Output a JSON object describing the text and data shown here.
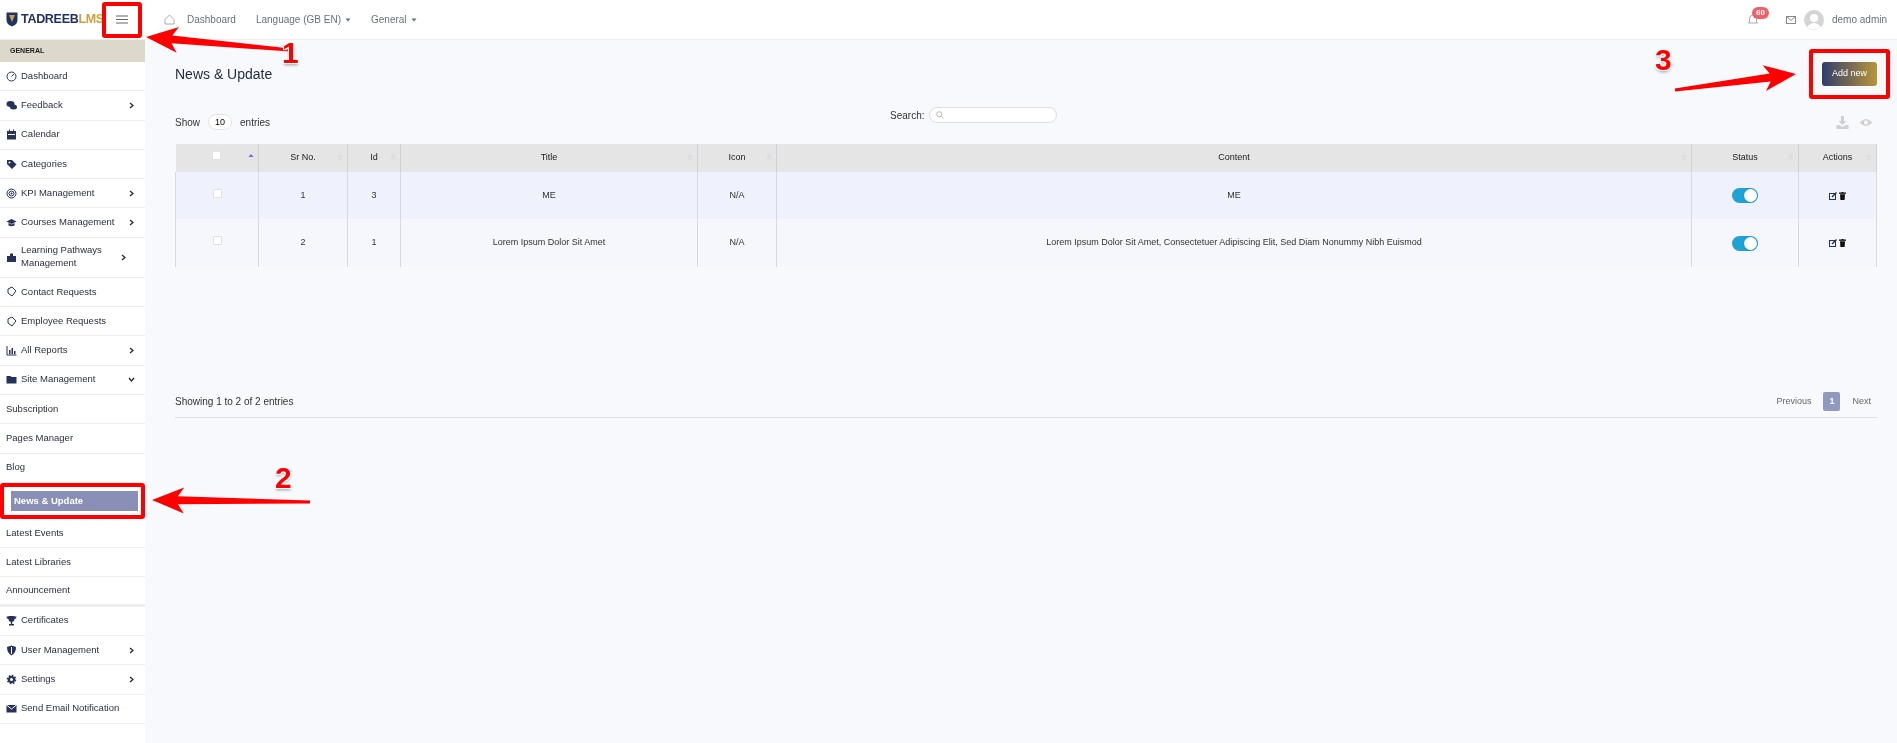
{
  "header": {
    "logo": {
      "primary": "TADREEB",
      "accent": "LMS"
    },
    "nav": [
      {
        "label": "Dashboard",
        "dropdown": false
      },
      {
        "label": "Language (GB EN)",
        "dropdown": true
      },
      {
        "label": "General",
        "dropdown": true
      }
    ],
    "notification_count": "60",
    "user_name": "demo admin"
  },
  "sidebar": {
    "section": "GENERAL",
    "items": [
      {
        "label": "Dashboard",
        "kind": "main",
        "selected": false
      },
      {
        "label": "Feedback",
        "kind": "main",
        "expanded": false,
        "selected": false
      },
      {
        "label": "Calendar",
        "kind": "main",
        "selected": false
      },
      {
        "label": "Categories",
        "kind": "main",
        "selected": false
      },
      {
        "label": "KPI Management",
        "kind": "main",
        "expanded": false,
        "selected": false
      },
      {
        "label": "Courses Management",
        "kind": "main",
        "expanded": false,
        "selected": false
      },
      {
        "label": "Learning Pathways Management",
        "kind": "main",
        "expanded": false,
        "selected": false
      },
      {
        "label": "Contact Requests",
        "kind": "main",
        "selected": false
      },
      {
        "label": "Employee Requests",
        "kind": "main",
        "selected": false
      },
      {
        "label": "All Reports",
        "kind": "main",
        "expanded": false,
        "selected": false
      },
      {
        "label": "Site Management",
        "kind": "main",
        "expanded": true,
        "selected": false
      },
      {
        "label": "Subscription",
        "kind": "sub",
        "selected": false
      },
      {
        "label": "Pages Manager",
        "kind": "sub",
        "selected": false
      },
      {
        "label": "Blog",
        "kind": "sub",
        "selected": false
      },
      {
        "label": "News & Update",
        "kind": "sub",
        "selected": true
      },
      {
        "label": "Latest Events",
        "kind": "sub",
        "selected": false
      },
      {
        "label": "Latest Libraries",
        "kind": "sub",
        "selected": false
      },
      {
        "label": "Announcement",
        "kind": "sub",
        "selected": false
      },
      {
        "label": "Certificates",
        "kind": "main",
        "selected": false
      },
      {
        "label": "User Management",
        "kind": "main",
        "expanded": false,
        "selected": false
      },
      {
        "label": "Settings",
        "kind": "main",
        "expanded": false,
        "selected": false
      },
      {
        "label": "Send Email Notification",
        "kind": "main",
        "selected": false
      }
    ]
  },
  "page": {
    "title": "News & Update",
    "add_button": "Add new",
    "length_prefix": "Show",
    "length_value": "10",
    "length_suffix": "entries",
    "search_label": "Search:"
  },
  "table": {
    "columns": [
      {
        "kind": "checkbox",
        "checked": false,
        "sorted": true
      },
      {
        "kind": "text",
        "label": "Sr No.",
        "sorted": false
      },
      {
        "kind": "text",
        "label": "Id",
        "sorted": false
      },
      {
        "kind": "text",
        "label": "Title",
        "sorted": false
      },
      {
        "kind": "text",
        "label": "Icon",
        "sorted": false
      },
      {
        "kind": "text",
        "label": "Content",
        "sorted": false
      },
      {
        "kind": "text",
        "label": "Status",
        "sorted": false
      },
      {
        "kind": "text",
        "label": "Actions",
        "sorted": false
      }
    ],
    "rows": [
      {
        "checked": false,
        "sr_no": "1",
        "id": "3",
        "title": "ME",
        "icon": "N/A",
        "content": "ME",
        "status_on": true
      },
      {
        "checked": false,
        "sr_no": "2",
        "id": "1",
        "title": "Lorem Ipsum Dolor Sit Amet",
        "icon": "N/A",
        "content": "Lorem Ipsum Dolor Sit Amet, Consectetuer Adipiscing Elit, Sed Diam Nonummy Nibh Euismod",
        "status_on": true
      }
    ]
  },
  "footer": {
    "info": "Showing 1 to 2 of 2 entries",
    "pagination": [
      {
        "label": "Previous",
        "selected": false
      },
      {
        "label": "1",
        "selected": true
      },
      {
        "label": "Next",
        "selected": false
      }
    ]
  },
  "annotations": [
    {
      "number": "1"
    },
    {
      "number": "2"
    },
    {
      "number": "3"
    }
  ]
}
